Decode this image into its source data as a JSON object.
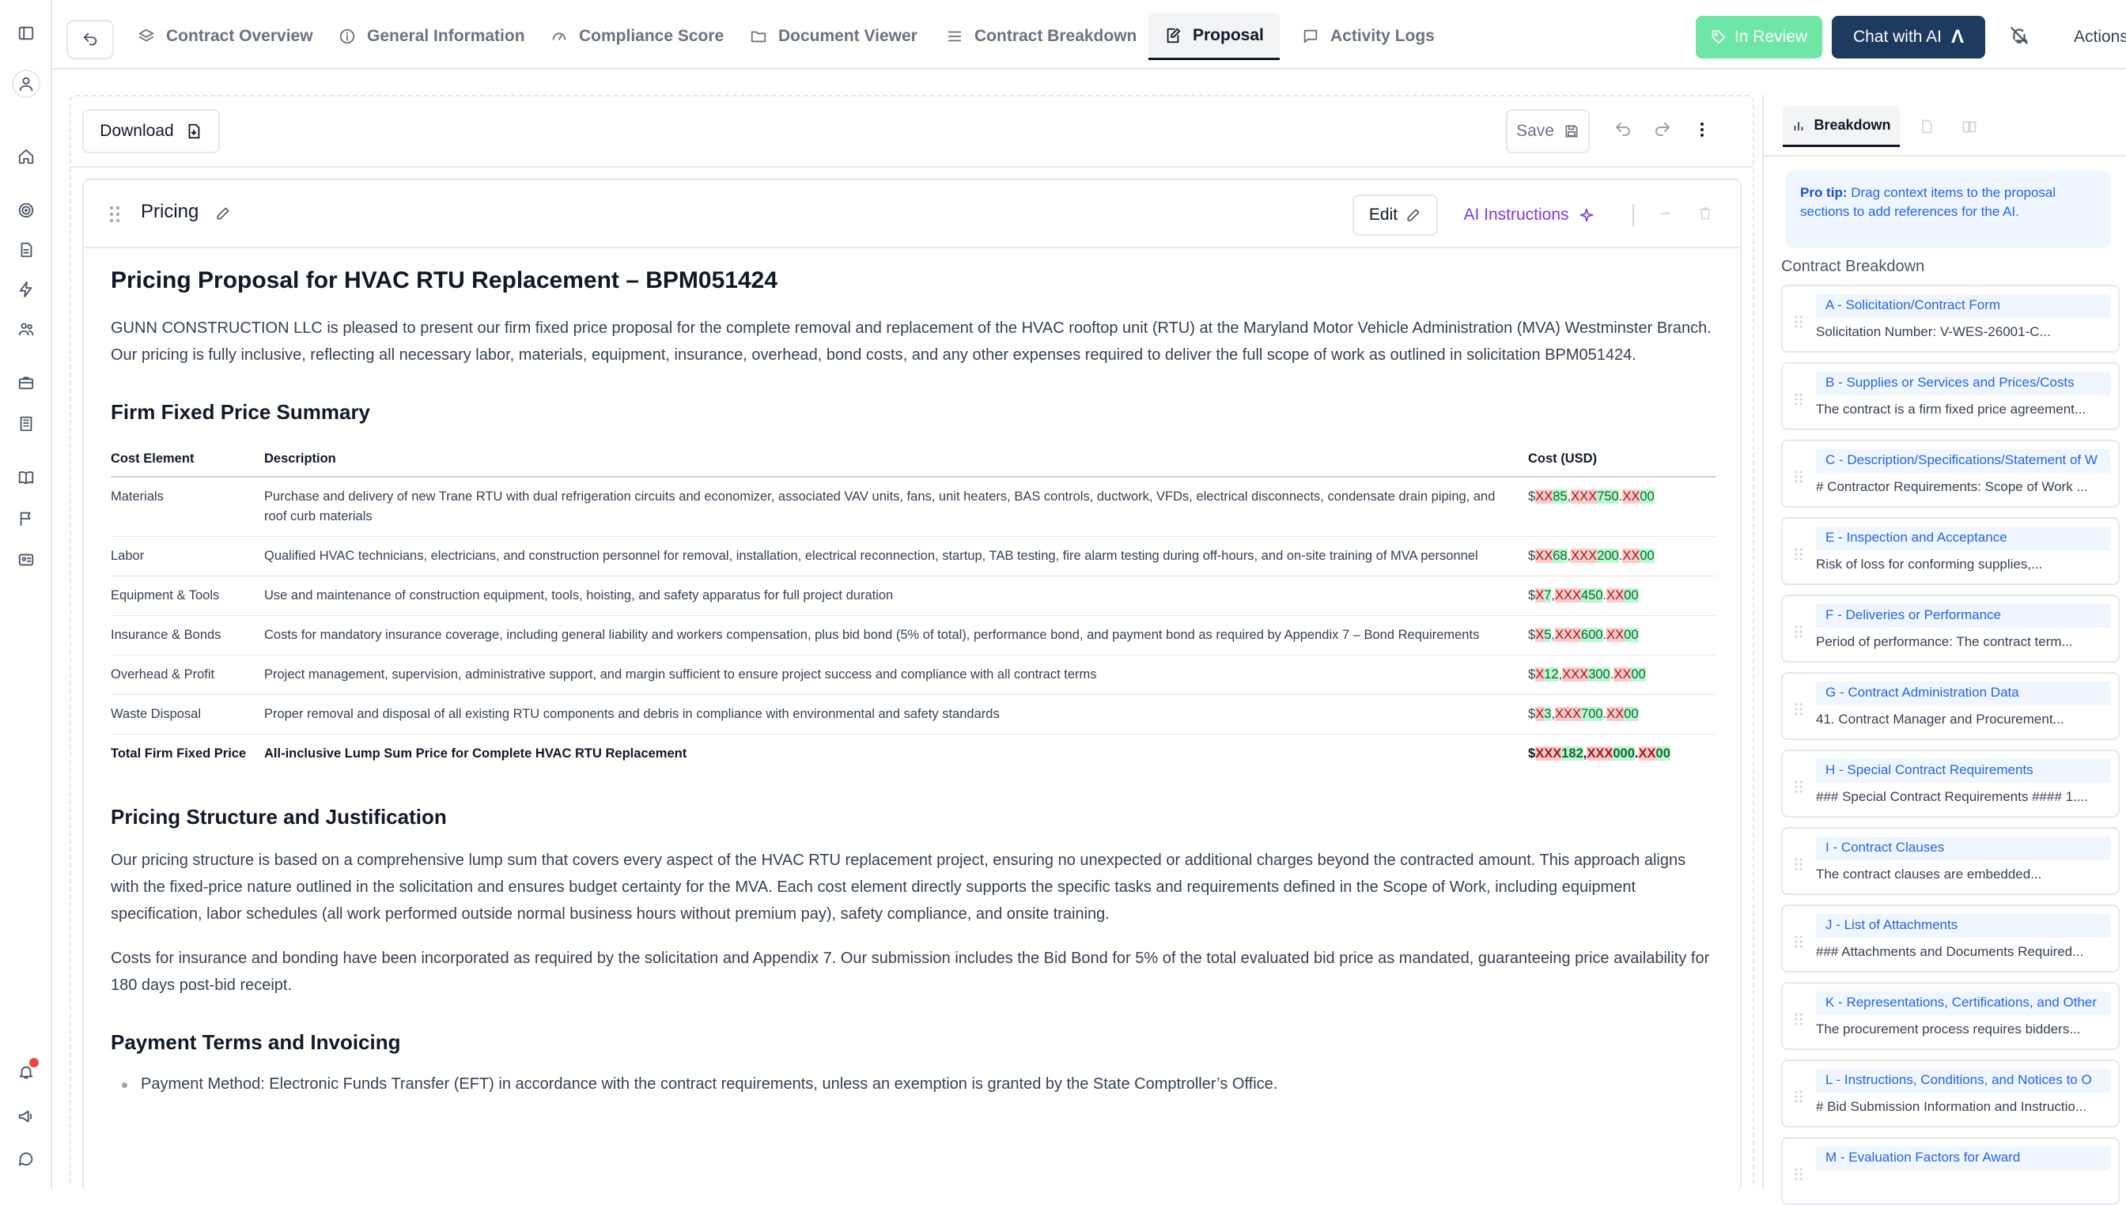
{
  "tabs": [
    {
      "label": "Contract Overview",
      "icon": "layers-icon"
    },
    {
      "label": "General Information",
      "icon": "info-icon"
    },
    {
      "label": "Compliance Score",
      "icon": "gauge-icon"
    },
    {
      "label": "Document Viewer",
      "icon": "folder-icon"
    },
    {
      "label": "Contract Breakdown",
      "icon": "list-icon"
    },
    {
      "label": "Proposal",
      "icon": "edit-doc-icon",
      "active": true
    },
    {
      "label": "Activity Logs",
      "icon": "message-icon"
    }
  ],
  "header": {
    "review_label": "In Review",
    "chat_label": "Chat  with AI",
    "actions_label": "Actions"
  },
  "toolbar": {
    "download_label": "Download",
    "save_label": "Save"
  },
  "section": {
    "title": "Pricing",
    "edit_label": "Edit",
    "ai_label": "AI Instructions"
  },
  "doc": {
    "title": "Pricing Proposal for HVAC RTU Replacement – BPM051424",
    "intro": "GUNN CONSTRUCTION LLC is pleased to present our firm fixed price proposal for the complete removal and replacement of the HVAC rooftop unit (RTU) at the Maryland Motor Vehicle Administration (MVA) Westminster Branch. Our pricing is fully inclusive, reflecting all necessary labor, materials, equipment, insurance, overhead, bond costs, and any other expenses required to deliver the full scope of work as outlined in solicitation BPM051424.",
    "summary_heading": "Firm Fixed Price Summary",
    "table_headers": [
      "Cost Element",
      "Description",
      "Cost (USD)"
    ],
    "rows": [
      {
        "element": "Materials",
        "desc": "Purchase and delivery of new Trane RTU with dual refrigeration circuits and economizer, associated VAV units, fans, unit heaters, BAS controls, ductwork, VFDs, electrical disconnects, condensate drain piping, and roof curb materials",
        "cost": {
          "a": "XX",
          "b": "85",
          "c": "XXX",
          "d": "750",
          "e": "XX",
          "f": "00"
        }
      },
      {
        "element": "Labor",
        "desc": "Qualified HVAC technicians, electricians, and construction personnel for removal, installation, electrical reconnection, startup, TAB testing, fire alarm testing during off-hours, and on-site training of MVA personnel",
        "cost": {
          "a": "XX",
          "b": "68",
          "c": "XXX",
          "d": "200",
          "e": "XX",
          "f": "00"
        }
      },
      {
        "element": "Equipment & Tools",
        "desc": "Use and maintenance of construction equipment, tools, hoisting, and safety apparatus for full project duration",
        "cost": {
          "a": "X",
          "b": "7",
          "c": "XXX",
          "d": "450",
          "e": "XX",
          "f": "00"
        }
      },
      {
        "element": "Insurance & Bonds",
        "desc": "Costs for mandatory insurance coverage, including general liability and workers compensation, plus bid bond (5% of total), performance bond, and payment bond as required by Appendix 7 – Bond Requirements",
        "cost": {
          "a": "X",
          "b": "5",
          "c": "XXX",
          "d": "600",
          "e": "XX",
          "f": "00"
        }
      },
      {
        "element": "Overhead & Profit",
        "desc": "Project management, supervision, administrative support, and margin sufficient to ensure project success and compliance with all contract terms",
        "cost": {
          "a": "X",
          "b": "12",
          "c": "XXX",
          "d": "300",
          "e": "XX",
          "f": "00"
        }
      },
      {
        "element": "Waste Disposal",
        "desc": "Proper removal and disposal of all existing RTU components and debris in compliance with environmental and safety standards",
        "cost": {
          "a": "X",
          "b": "3",
          "c": "XXX",
          "d": "700",
          "e": "XX",
          "f": "00"
        }
      }
    ],
    "total": {
      "element": "Total Firm Fixed Price",
      "desc": "All-inclusive Lump Sum Price for Complete HVAC RTU Replacement",
      "cost": {
        "a": "XXX",
        "b": "182",
        "c": "XXX",
        "d": "000",
        "e": "XX",
        "f": "00"
      }
    },
    "structure_heading": "Pricing Structure and Justification",
    "structure_p1": "Our pricing structure is based on a comprehensive lump sum that covers every aspect of the HVAC RTU replacement project, ensuring no unexpected or additional charges beyond the contracted amount. This approach aligns with the fixed-price nature outlined in the solicitation and ensures budget certainty for the MVA. Each cost element directly supports the specific tasks and requirements defined in the Scope of Work, including equipment specification, labor schedules (all work performed outside normal business hours without premium pay), safety compliance, and onsite training.",
    "structure_p2": "Costs for insurance and bonding have been incorporated as required by the solicitation and Appendix 7. Our submission includes the Bid Bond for 5% of the total evaluated bid price as mandated, guaranteeing price availability for 180 days post-bid receipt.",
    "payment_heading": "Payment Terms and Invoicing",
    "payment_item": "Payment Method: Electronic Funds Transfer (EFT) in accordance with the contract requirements, unless an exemption is granted by the State Comptroller’s Office."
  },
  "panel": {
    "tab_label": "Breakdown",
    "protip_bold": "Pro tip:",
    "protip_text": " Drag context items to the proposal sections to add references for the AI.",
    "section_title": "Contract Breakdown",
    "items": [
      {
        "label": "A - Solicitation/Contract Form",
        "snippet": "Solicitation Number: V-WES-26001-C..."
      },
      {
        "label": "B - Supplies or Services and Prices/Costs",
        "snippet": "The contract is a firm fixed price agreement..."
      },
      {
        "label": "C - Description/Specifications/Statement of W",
        "snippet": "# Contractor Requirements: Scope of Work ..."
      },
      {
        "label": "E - Inspection and Acceptance",
        "snippet": "Risk of loss for conforming supplies,..."
      },
      {
        "label": "F - Deliveries or Performance",
        "snippet": "Period of performance: The contract term..."
      },
      {
        "label": "G - Contract Administration Data",
        "snippet": "41. Contract Manager and Procurement..."
      },
      {
        "label": "H - Special Contract Requirements",
        "snippet": "### Special Contract Requirements #### 1...."
      },
      {
        "label": "I - Contract Clauses",
        "snippet": "The contract clauses are embedded..."
      },
      {
        "label": "J - List of Attachments",
        "snippet": "### Attachments and Documents Required..."
      },
      {
        "label": "K - Representations, Certifications, and Other",
        "snippet": "The procurement process requires bidders..."
      },
      {
        "label": "L - Instructions, Conditions, and Notices to O",
        "snippet": "# Bid Submission Information and Instructio..."
      },
      {
        "label": "M - Evaluation Factors for Award",
        "snippet": ""
      }
    ]
  }
}
